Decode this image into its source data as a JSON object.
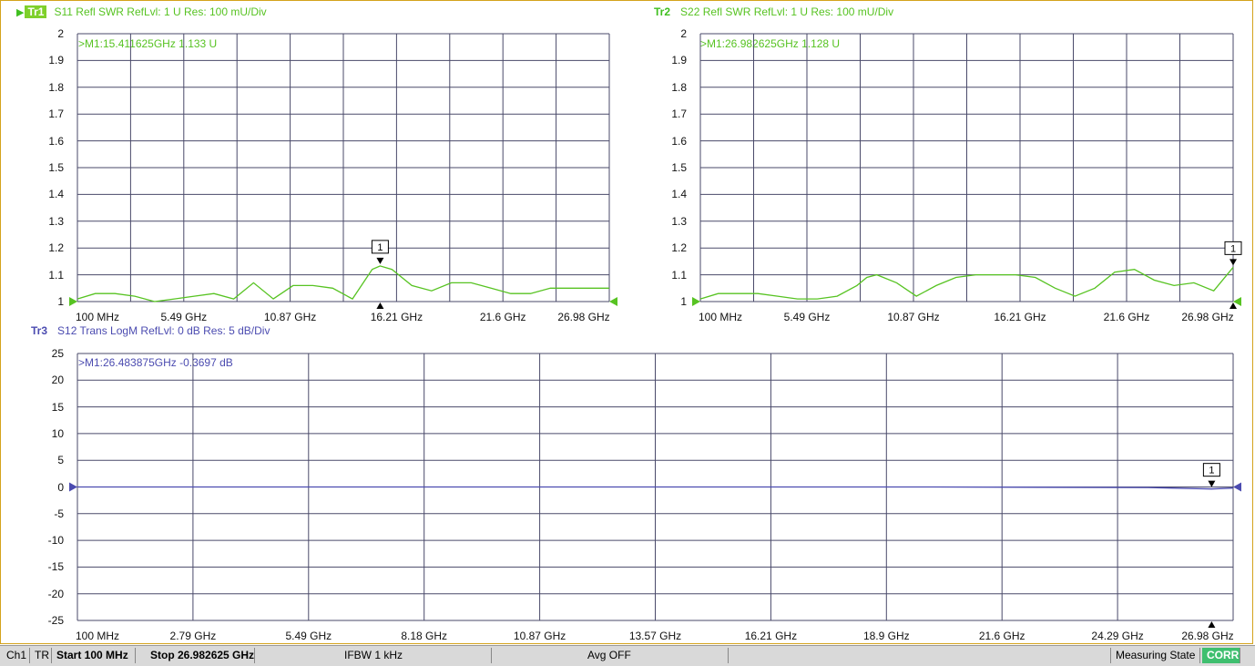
{
  "traces": [
    {
      "id": "Tr1",
      "header": "S11 Refl SWR RefLvl: 1  U Res: 100 mU/Div",
      "marker_readout": ">M1:15.411625GHz  1.133  U",
      "marker_label": "1",
      "color": "#57c322",
      "y_ticks": [
        "2",
        "1.9",
        "1.8",
        "1.7",
        "1.6",
        "1.5",
        "1.4",
        "1.3",
        "1.2",
        "1.1",
        "1"
      ],
      "x_ticks": [
        "100 MHz",
        "5.49 GHz",
        "10.87 GHz",
        "16.21 GHz",
        "21.6 GHz",
        "26.98 GHz"
      ]
    },
    {
      "id": "Tr2",
      "header": "S22 Refl SWR RefLvl: 1  U Res: 100 mU/Div",
      "marker_readout": ">M1:26.982625GHz  1.128  U",
      "marker_label": "1",
      "color": "#57c322",
      "y_ticks": [
        "2",
        "1.9",
        "1.8",
        "1.7",
        "1.6",
        "1.5",
        "1.4",
        "1.3",
        "1.2",
        "1.1",
        "1"
      ],
      "x_ticks": [
        "100 MHz",
        "5.49 GHz",
        "10.87 GHz",
        "16.21 GHz",
        "21.6 GHz",
        "26.98 GHz"
      ]
    },
    {
      "id": "Tr3",
      "header": "S12 Trans LogM RefLvl: 0  dB Res: 5  dB/Div",
      "marker_readout": ">M1:26.483875GHz  -0.3697  dB",
      "marker_label": "1",
      "color": "#4b4bb0",
      "y_ticks": [
        "25",
        "20",
        "15",
        "10",
        "5",
        "0",
        "-5",
        "-10",
        "-15",
        "-20",
        "-25"
      ],
      "x_ticks": [
        "100 MHz",
        "2.79 GHz",
        "5.49 GHz",
        "8.18 GHz",
        "10.87 GHz",
        "13.57 GHz",
        "16.21 GHz",
        "18.9 GHz",
        "21.6 GHz",
        "24.29 GHz",
        "26.98 GHz"
      ]
    }
  ],
  "chart_data": [
    {
      "type": "line",
      "series": [
        {
          "x": [
            0.1,
            1,
            2,
            3,
            4,
            5,
            6,
            7,
            8,
            8.5,
            9,
            10,
            11,
            12,
            13,
            14,
            15,
            15.4,
            16,
            17,
            18,
            19,
            20,
            21,
            22,
            23,
            24,
            25,
            26,
            27
          ],
          "y": [
            1.01,
            1.03,
            1.03,
            1.02,
            1.0,
            1.01,
            1.02,
            1.03,
            1.01,
            1.04,
            1.07,
            1.01,
            1.06,
            1.06,
            1.05,
            1.01,
            1.12,
            1.133,
            1.12,
            1.06,
            1.04,
            1.07,
            1.07,
            1.05,
            1.03,
            1.03,
            1.05,
            1.05,
            1.05,
            1.05
          ]
        }
      ],
      "xlim": [
        0.1,
        26.98
      ],
      "ylim": [
        1,
        2
      ]
    },
    {
      "type": "line",
      "series": [
        {
          "x": [
            0.1,
            1,
            2,
            3,
            4,
            5,
            6,
            7,
            8,
            8.5,
            9,
            10,
            11,
            12,
            13,
            14,
            15,
            16,
            17,
            18,
            19,
            20,
            21,
            22,
            23,
            24,
            25,
            26,
            26.98
          ],
          "y": [
            1.01,
            1.03,
            1.03,
            1.03,
            1.02,
            1.01,
            1.01,
            1.02,
            1.06,
            1.09,
            1.1,
            1.07,
            1.02,
            1.06,
            1.09,
            1.1,
            1.1,
            1.1,
            1.09,
            1.05,
            1.02,
            1.05,
            1.11,
            1.12,
            1.08,
            1.06,
            1.07,
            1.04,
            1.128
          ]
        }
      ],
      "xlim": [
        0.1,
        26.98
      ],
      "ylim": [
        1,
        2
      ]
    },
    {
      "type": "line",
      "series": [
        {
          "x": [
            0.1,
            5,
            10,
            15,
            20,
            25,
            26.48,
            26.98
          ],
          "y": [
            0,
            0,
            0,
            0,
            0,
            -0.1,
            -0.37,
            -0.2
          ]
        }
      ],
      "xlim": [
        0.1,
        26.98
      ],
      "ylim": [
        -25,
        25
      ]
    }
  ],
  "statusbar": {
    "channel": "Ch1",
    "mode": "TR",
    "start": "Start 100 MHz",
    "stop": "Stop 26.982625 GHz",
    "ifbw": "IFBW 1 kHz",
    "avg": "Avg OFF",
    "state": "Measuring State",
    "corr": "CORR"
  },
  "colors": {
    "border": "#d4a31c",
    "grid": "#4a4a6a",
    "trace_green": "#57c322",
    "trace_blue": "#4b4bb0",
    "corr_bg": "#3fbf6f"
  }
}
